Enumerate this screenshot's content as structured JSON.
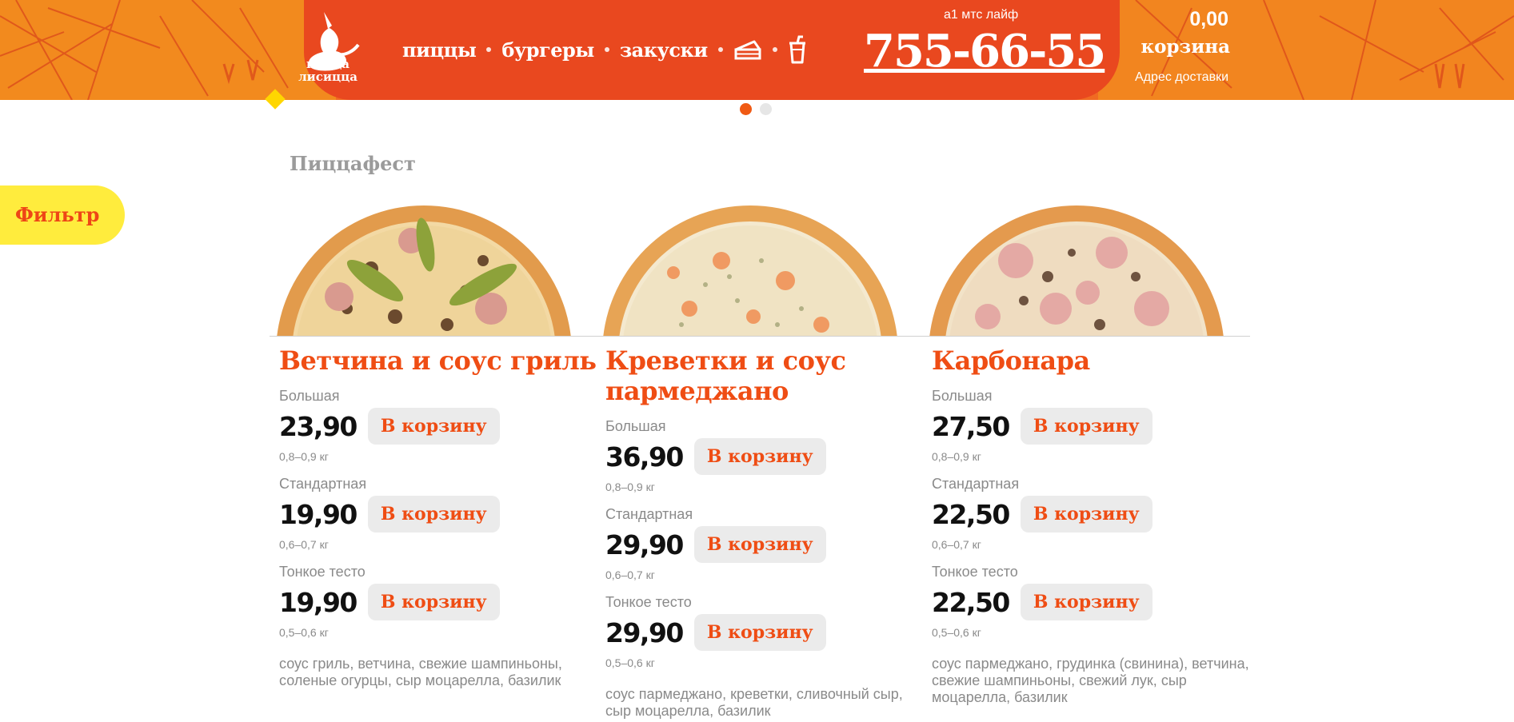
{
  "header": {
    "logo_text": "пицца лисицца",
    "nav": [
      "пиццы",
      "бургеры",
      "закуски"
    ],
    "nav_icons": [
      "cake-icon",
      "drink-icon"
    ],
    "phone_label": "а1 мтс лайф",
    "phone": "755-66-55",
    "cart_sum": "0,00",
    "cart_label": "корзина",
    "address": "Адрес доставки",
    "colors": {
      "orange": "#f28a1e",
      "red": "#e9481f",
      "accent": "#ef4d14",
      "yellow": "#ffec3d"
    }
  },
  "carousel": {
    "pages": 2,
    "active": 1
  },
  "section": {
    "title": "Пиццафест"
  },
  "filter": {
    "label": "Фильтр"
  },
  "cart_button_label": "В корзину",
  "products": [
    {
      "title": "Ветчина и соус гриль",
      "sizes": [
        {
          "name": "Большая",
          "price": "23,90",
          "weight": "0,8–0,9 кг"
        },
        {
          "name": "Стандартная",
          "price": "19,90",
          "weight": "0,6–0,7 кг"
        },
        {
          "name": "Тонкое тесто",
          "price": "19,90",
          "weight": "0,5–0,6 кг"
        }
      ],
      "ingredients": "соус гриль, ветчина, свежие шампиньоны, соленые огурцы, сыр моцарелла, базилик"
    },
    {
      "title": "Креветки и соус пармеджано",
      "sizes": [
        {
          "name": "Большая",
          "price": "36,90",
          "weight": "0,8–0,9 кг"
        },
        {
          "name": "Стандартная",
          "price": "29,90",
          "weight": "0,6–0,7 кг"
        },
        {
          "name": "Тонкое тесто",
          "price": "29,90",
          "weight": "0,5–0,6 кг"
        }
      ],
      "ingredients": "соус пармеджано, креветки, сливочный сыр, сыр моцарелла, базилик"
    },
    {
      "title": "Карбонара",
      "sizes": [
        {
          "name": "Большая",
          "price": "27,50",
          "weight": "0,8–0,9 кг"
        },
        {
          "name": "Стандартная",
          "price": "22,50",
          "weight": "0,6–0,7 кг"
        },
        {
          "name": "Тонкое тесто",
          "price": "22,50",
          "weight": "0,5–0,6 кг"
        }
      ],
      "ingredients": "соус пармеджано, грудинка (свинина), ветчина, свежие шампиньоны, свежий лук, сыр моцарелла, базилик"
    }
  ]
}
